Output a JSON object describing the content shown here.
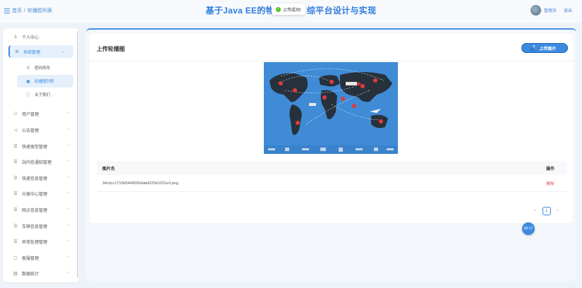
{
  "header": {
    "breadcrumb_home": "首页",
    "breadcrumb_sep": "/",
    "breadcrumb_current": "轮播图列表",
    "title_left": "基于Java EE的物",
    "title_right": "综平台设计与实现",
    "user_name": "管理员",
    "logout": "退出"
  },
  "toast": {
    "text": "上传成功!",
    "icon": "check-circle-icon"
  },
  "sidebar": {
    "items": [
      {
        "label": "个人中心",
        "icon": "user-icon"
      },
      {
        "label": "系统管理",
        "icon": "gear-icon",
        "expanded": true
      },
      {
        "label": "用户管理",
        "icon": "users-icon"
      },
      {
        "label": "公告管理",
        "icon": "speaker-icon"
      },
      {
        "label": "快递类型管理",
        "icon": "list-icon"
      },
      {
        "label": "站内信通知管理",
        "icon": "list-icon"
      },
      {
        "label": "快递信息管理",
        "icon": "list-icon"
      },
      {
        "label": "分拨中心管理",
        "icon": "list-icon"
      },
      {
        "label": "网点信息管理",
        "icon": "list-icon"
      },
      {
        "label": "车辆信息管理",
        "icon": "list-icon"
      },
      {
        "label": "异常处理管理",
        "icon": "list-icon"
      },
      {
        "label": "客服管理",
        "icon": "chat-icon"
      },
      {
        "label": "数据统计",
        "icon": "chart-icon"
      }
    ],
    "subitems": [
      {
        "label": "密码修改",
        "icon": "key-icon"
      },
      {
        "label": "轮播图列表",
        "icon": "image-icon",
        "active": true
      },
      {
        "label": "关于我们",
        "icon": "info-icon"
      }
    ]
  },
  "panel": {
    "title": "上传轮播图",
    "upload_button": "上传图片"
  },
  "table": {
    "columns": [
      "图片名",
      "操作"
    ],
    "rows": [
      {
        "name": "34cbcc1710b54445054abd220d1201e3.png",
        "action": "删除"
      }
    ]
  },
  "pager": {
    "prev": "<",
    "current": "1",
    "next": ">"
  },
  "timer": "00:17",
  "colors": {
    "accent": "#3b8ae0",
    "title": "#2f7de0",
    "danger": "#e04a4a",
    "success": "#52c41a"
  }
}
